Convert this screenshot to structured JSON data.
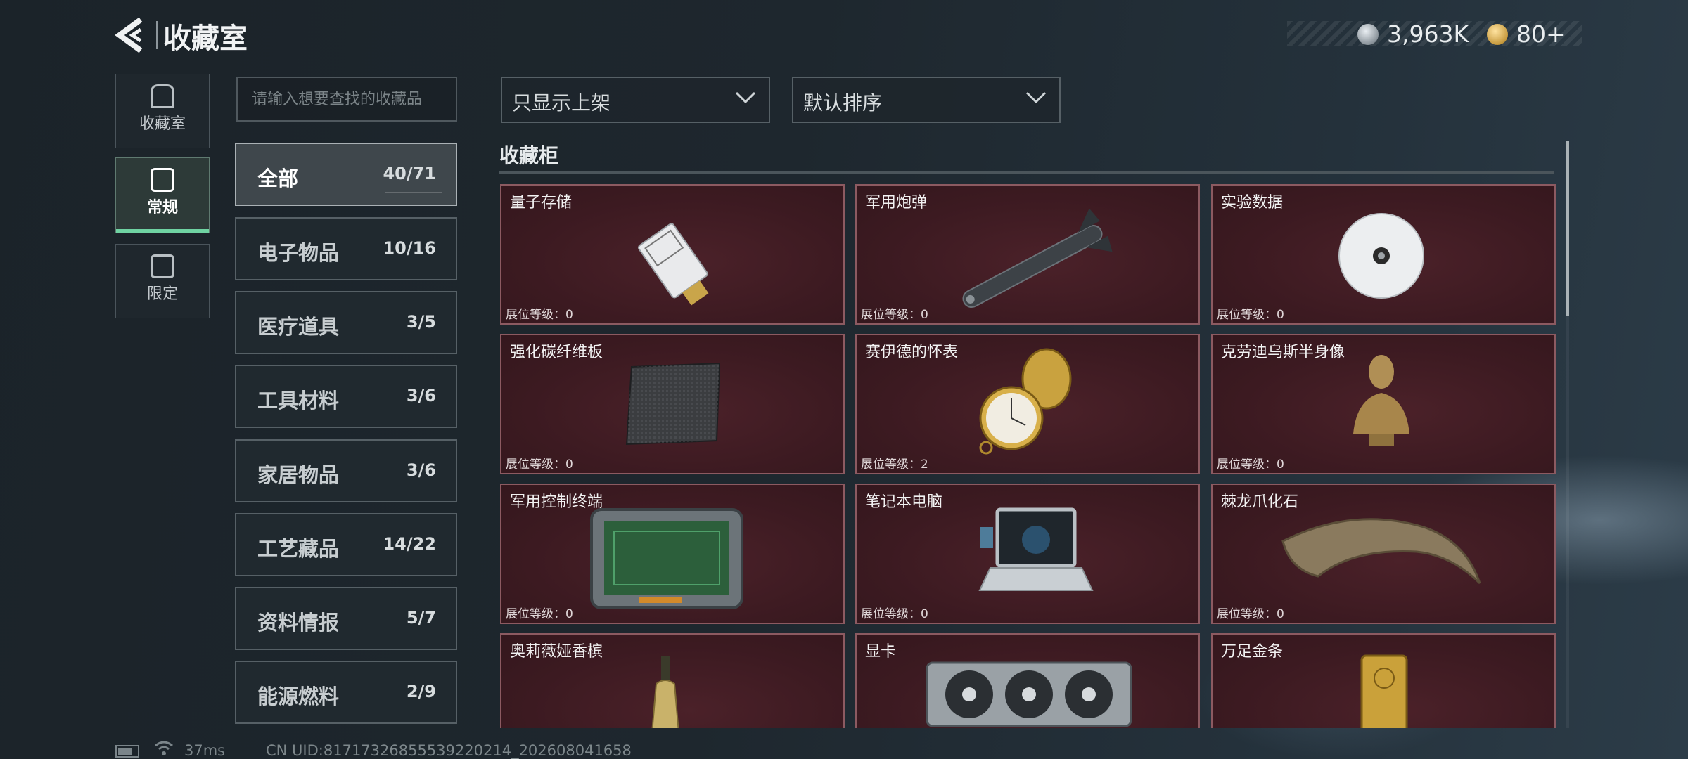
{
  "header": {
    "title": "收藏室",
    "currency": [
      {
        "icon": "silver-coin-icon",
        "value": "3,963K"
      },
      {
        "icon": "gold-coin-icon",
        "value": "80+"
      }
    ]
  },
  "rail": {
    "items": [
      {
        "label": "收藏室",
        "icon": "trophy-case-icon"
      },
      {
        "label": "常规",
        "icon": "document-icon"
      },
      {
        "label": "限定",
        "icon": "limited-icon"
      }
    ]
  },
  "search": {
    "placeholder": "请输入想要查找的收藏品"
  },
  "filters": {
    "display": "只显示上架",
    "sort": "默认排序"
  },
  "categories": [
    {
      "name": "全部",
      "count": "40/71"
    },
    {
      "name": "电子物品",
      "count": "10/16"
    },
    {
      "name": "医疗道具",
      "count": "3/5"
    },
    {
      "name": "工具材料",
      "count": "3/6"
    },
    {
      "name": "家居物品",
      "count": "3/6"
    },
    {
      "name": "工艺藏品",
      "count": "14/22"
    },
    {
      "name": "资料情报",
      "count": "5/7"
    },
    {
      "name": "能源燃料",
      "count": "2/9"
    }
  ],
  "section": {
    "title": "收藏柜"
  },
  "items": [
    {
      "name": "量子存储",
      "level": "展位等级：0",
      "icon": "usb-drive-icon"
    },
    {
      "name": "军用炮弹",
      "level": "展位等级：0",
      "icon": "missile-icon"
    },
    {
      "name": "实验数据",
      "level": "展位等级：0",
      "icon": "disc-icon"
    },
    {
      "name": "强化碳纤维板",
      "level": "展位等级：0",
      "icon": "carbon-plate-icon"
    },
    {
      "name": "赛伊德的怀表",
      "level": "展位等级：2",
      "icon": "pocket-watch-icon"
    },
    {
      "name": "克劳迪乌斯半身像",
      "level": "展位等级：0",
      "icon": "bust-icon"
    },
    {
      "name": "军用控制终端",
      "level": "展位等级：0",
      "icon": "control-terminal-icon"
    },
    {
      "name": "笔记本电脑",
      "level": "展位等级：0",
      "icon": "laptop-icon"
    },
    {
      "name": "棘龙爪化石",
      "level": "展位等级：0",
      "icon": "claw-fossil-icon"
    },
    {
      "name": "奥莉薇娅香槟",
      "level": "",
      "icon": "champagne-icon"
    },
    {
      "name": "显卡",
      "level": "",
      "icon": "graphics-card-icon"
    },
    {
      "name": "万足金条",
      "level": "",
      "icon": "gold-bar-icon"
    }
  ],
  "footer": {
    "ping": "37ms",
    "uid": "CN UID:817173268555392202​14_202608041658"
  },
  "colors": {
    "accent_green": "#6fd3a2",
    "card_bg": "#3c1a21",
    "card_border": "#8c5a61"
  }
}
